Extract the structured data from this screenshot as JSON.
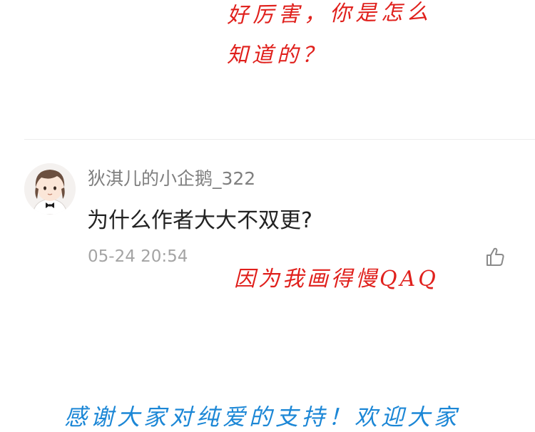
{
  "annotations": {
    "top_line_1": "好厉害，你是怎么",
    "top_line_2": "知道的？",
    "middle": "因为我画得慢QAQ",
    "bottom": "感谢大家对纯爱的支持！欢迎大家"
  },
  "comment": {
    "username": "狄淇儿的小企鹅_322",
    "text": "为什么作者大大不双更?",
    "timestamp": "05-24 20:54",
    "like_icon": "thumbs-up-icon"
  },
  "colors": {
    "annotation_red": "#e0201c",
    "annotation_blue": "#1c87d6",
    "username_gray": "#7f7f7f",
    "timestamp_gray": "#a4a4a4"
  }
}
